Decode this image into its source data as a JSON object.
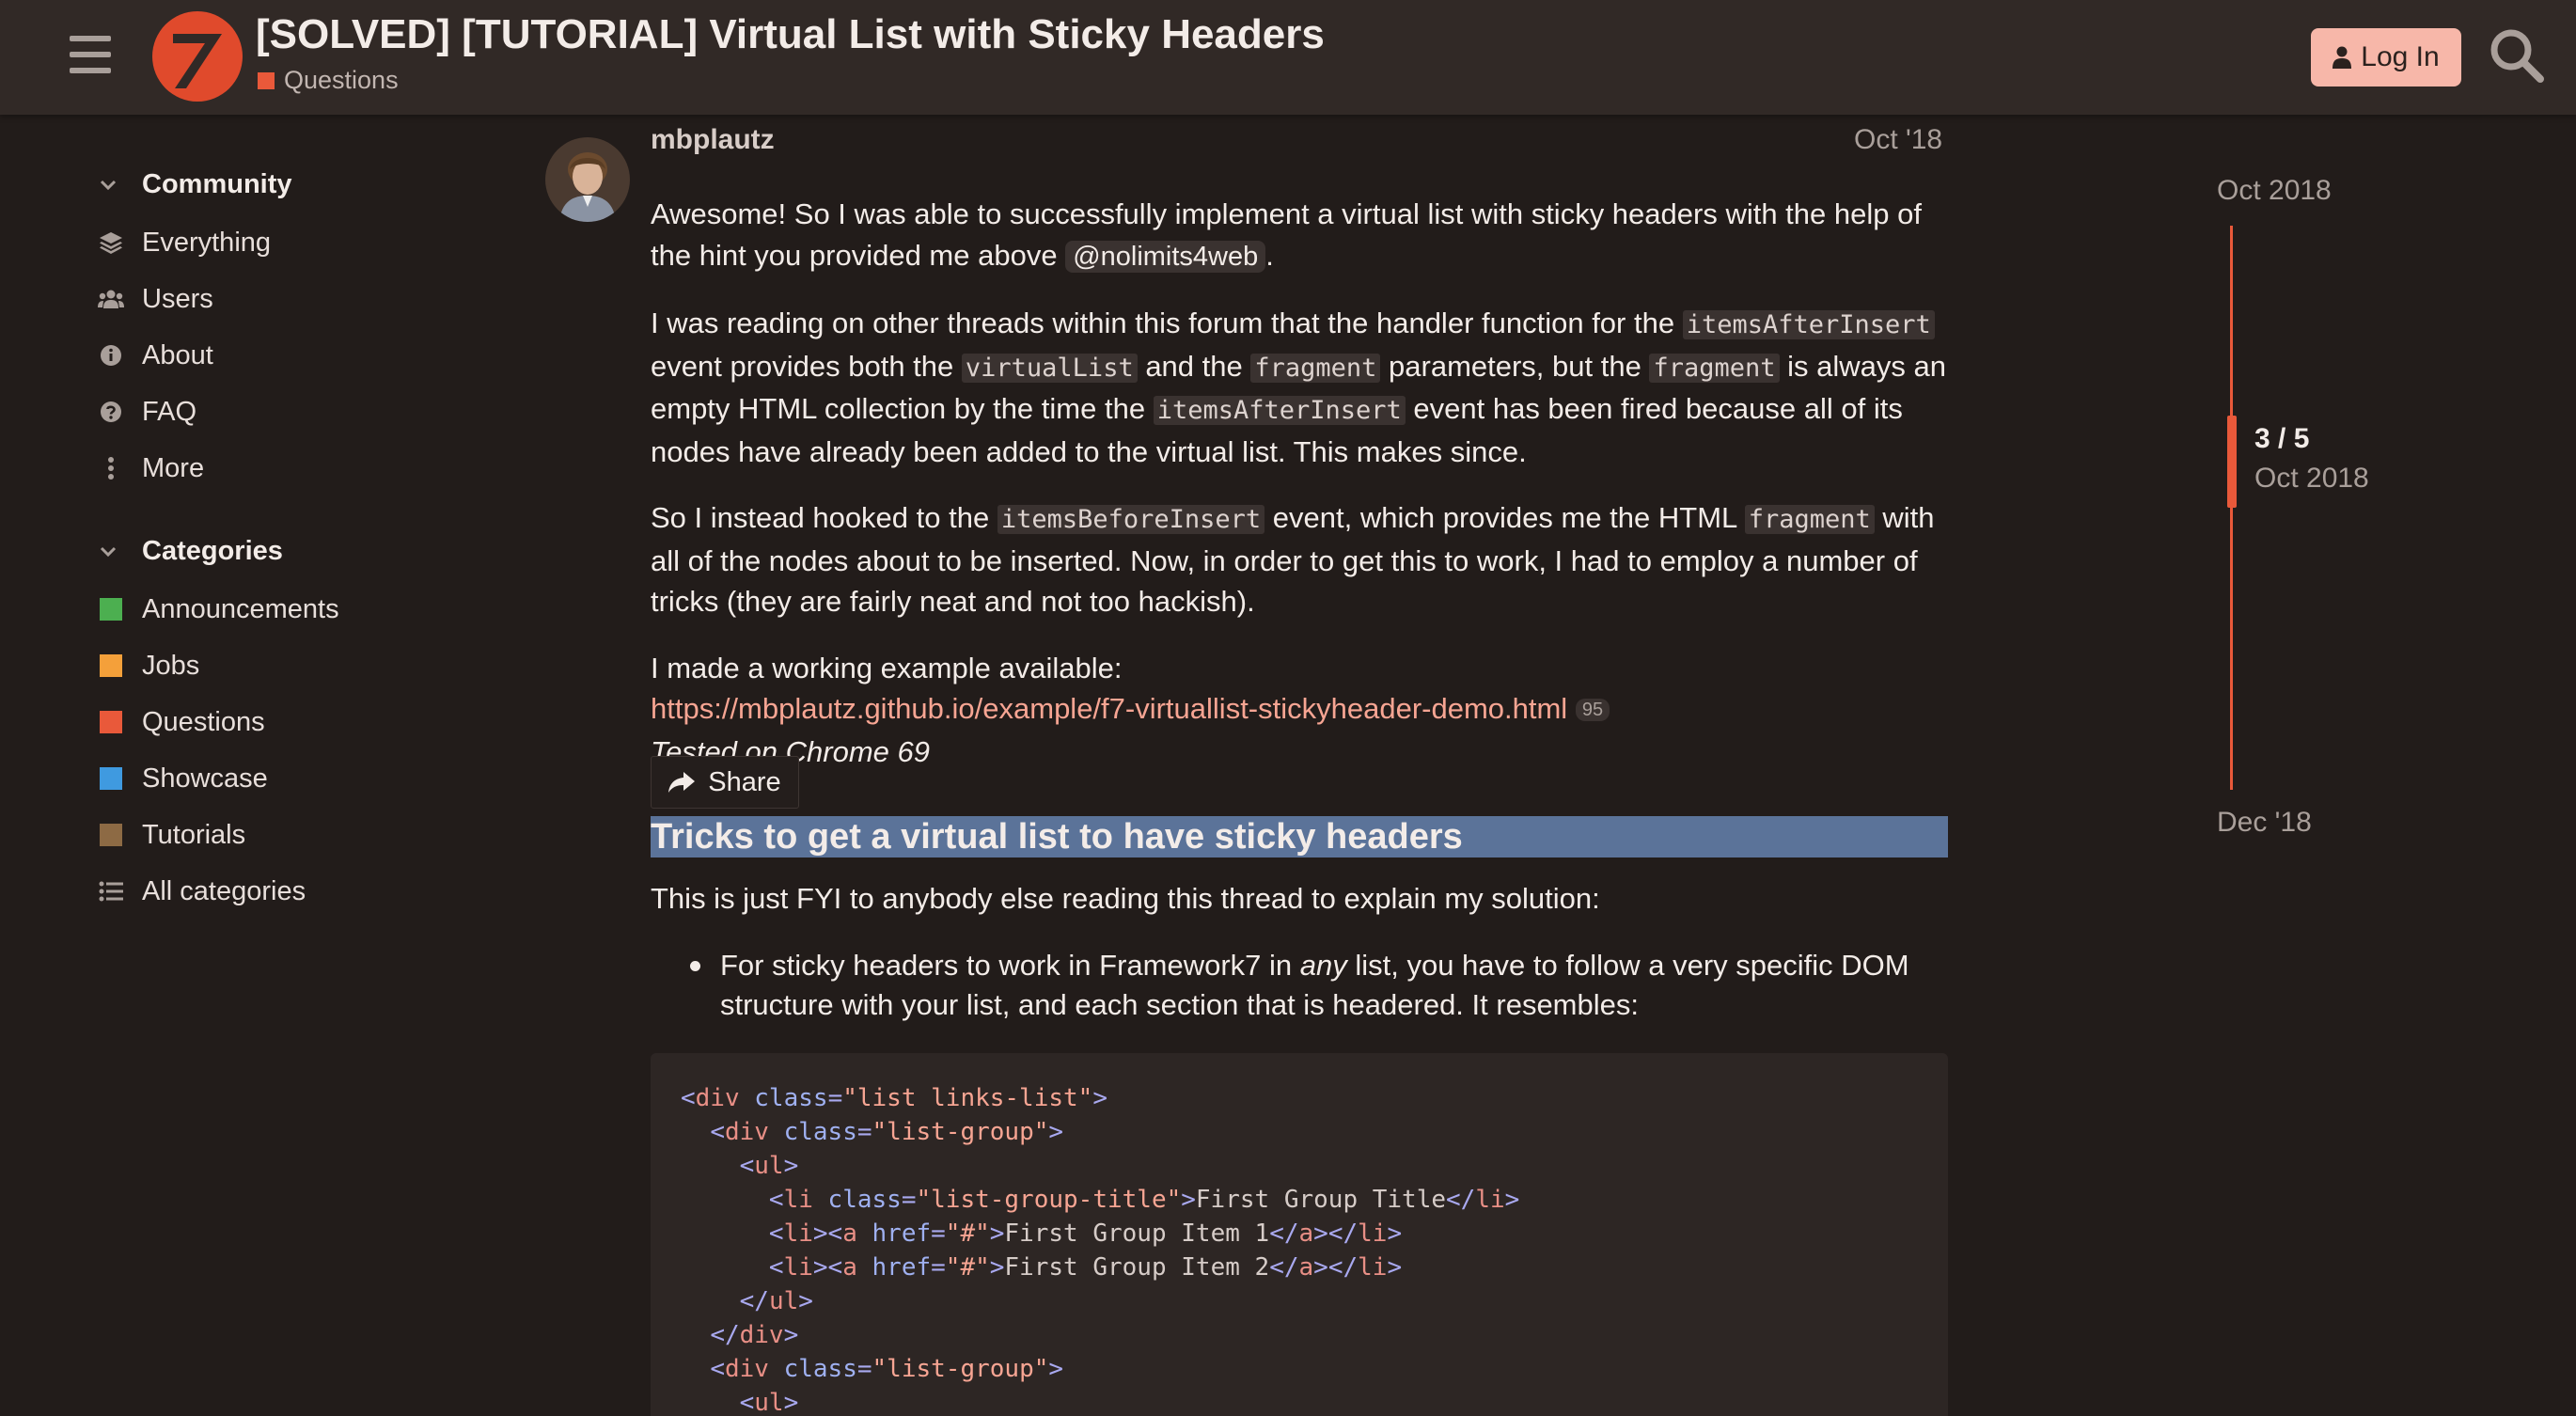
{
  "header": {
    "title": "[SOLVED] [TUTORIAL] Virtual List with Sticky Headers",
    "category": "Questions",
    "category_color": "#e9593a",
    "login_label": "Log In",
    "icons": [
      "hamburger-icon",
      "framework7-logo",
      "user-icon",
      "search-icon"
    ]
  },
  "sidebar": {
    "community_label": "Community",
    "community_items": [
      {
        "label": "Everything",
        "icon": "layers-icon"
      },
      {
        "label": "Users",
        "icon": "users-icon"
      },
      {
        "label": "About",
        "icon": "info-icon"
      },
      {
        "label": "FAQ",
        "icon": "question-icon"
      },
      {
        "label": "More",
        "icon": "ellipsis-vertical-icon"
      }
    ],
    "categories_label": "Categories",
    "category_items": [
      {
        "label": "Announcements",
        "color": "#4caf50"
      },
      {
        "label": "Jobs",
        "color": "#f4a03a"
      },
      {
        "label": "Questions",
        "color": "#e9593a"
      },
      {
        "label": "Showcase",
        "color": "#3f9ae0"
      },
      {
        "label": "Tutorials",
        "color": "#8d6a44"
      }
    ],
    "all_categories_label": "All categories"
  },
  "post": {
    "username": "mbplautz",
    "date": "Oct '18",
    "p1_text": "Awesome! So I was able to successfully implement a virtual list with sticky headers with the help of the hint you provided me above ",
    "p1_mention": "@nolimits4web",
    "p1_end": ".",
    "p2": {
      "t1": "I was reading on other threads within this forum that the handler function for the ",
      "c1": "itemsAfterInsert",
      "t2": " event provides both the ",
      "c2": "virtualList",
      "t3": " and the ",
      "c3": "fragment",
      "t4": " parameters, but the ",
      "c4": "fragment",
      "t5": " is always an empty HTML collection by the time the ",
      "c5": "itemsAfterInsert",
      "t6": " event has been fired because all of its nodes have already been added to the virtual list. This makes since."
    },
    "p3": {
      "t1": "So I instead hooked to the ",
      "c1": "itemsBeforeInsert",
      "t2": " event, which provides me the HTML ",
      "c2": "fragment",
      "t3": " with all of the nodes about to be inserted. Now, in order to get this to work, I had to employ a number of tricks (they are fairly neat and not too hackish)."
    },
    "p4_text": "I made a working example available:",
    "link_url": "https://mbplautz.github.io/example/f7-virtuallist-stickyheader-demo.html",
    "link_clicks": "95",
    "tested": "Tested on Chrome 69",
    "share_label": "Share",
    "heading": "Tricks to get a virtual list to have sticky headers",
    "fyi": "This is just FYI to anybody else reading this thread to explain my solution:",
    "bullet_a": "For sticky headers to work in Framework7 in ",
    "bullet_em": "any",
    "bullet_b": " list, you have to follow a very specific DOM structure with your list, and each section that is headered. It resembles:",
    "code_lines": [
      "<div class=\"list links-list\">",
      "  <div class=\"list-group\">",
      "    <ul>",
      "      <li class=\"list-group-title\">First Group Title</li>",
      "      <li><a href=\"#\">First Group Item 1</a></li>",
      "      <li><a href=\"#\">First Group Item 2</a></li>",
      "    </ul>",
      "  </div>",
      "  <div class=\"list-group\">",
      "    <ul>"
    ]
  },
  "timeline": {
    "start": "Oct 2018",
    "position": "3 / 5",
    "position_date": "Oct 2018",
    "end": "Dec '18",
    "accent": "#e9593a"
  }
}
